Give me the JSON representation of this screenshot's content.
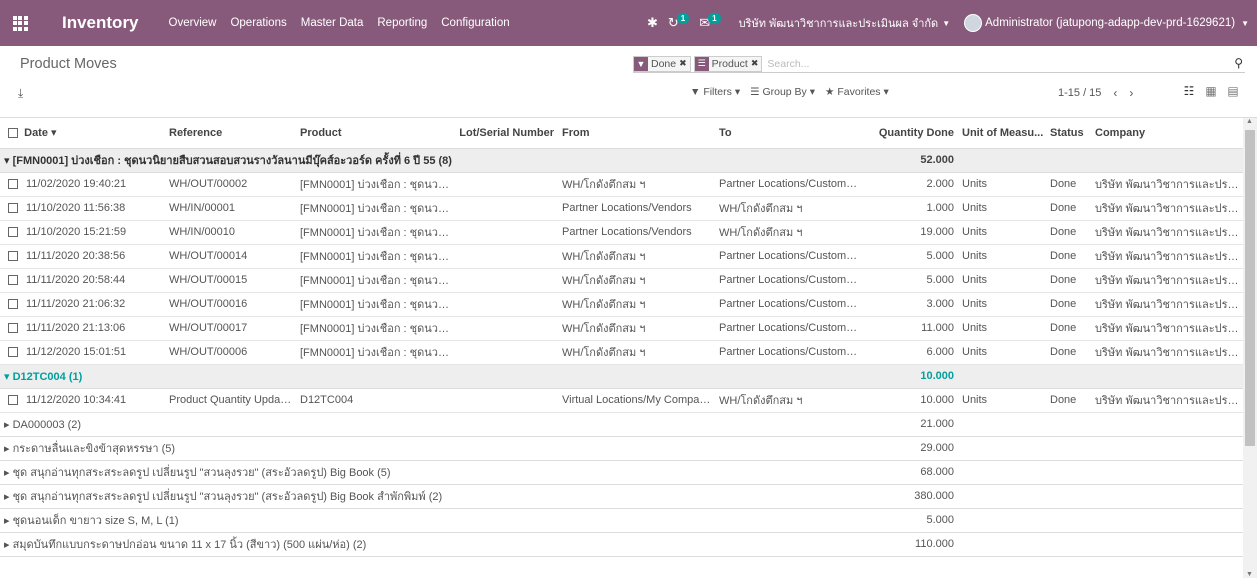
{
  "navbar": {
    "app_title": "Inventory",
    "menu": [
      "Overview",
      "Operations",
      "Master Data",
      "Reporting",
      "Configuration"
    ],
    "activity_badge": "1",
    "messages_badge": "1",
    "company": "บริษัท พัฒนาวิชาการและประเมินผล จำกัด",
    "user": "Administrator (jatupong-adapp-dev-prd-1629621)"
  },
  "control_panel": {
    "breadcrumb": "Product Moves",
    "facets": [
      "Done",
      "Product"
    ],
    "search_placeholder": "Search...",
    "filters_label": "Filters",
    "groupby_label": "Group By",
    "favorites_label": "Favorites",
    "pager": "1-15 / 15"
  },
  "columns": [
    "Date",
    "Reference",
    "Product",
    "Lot/Serial Number",
    "From",
    "To",
    "Quantity Done",
    "Unit of Measu...",
    "Status",
    "Company"
  ],
  "groups": [
    {
      "label": "▾ [FMN0001] บ่วงเชือก : ชุดนวนิยายสืบสวนสอบสวนรางวัลนานมีบุ๊คส์อะวอร์ด ครั้งที่ 6 ปี 55 (8)",
      "total": "52.000",
      "state": "open",
      "rows": [
        {
          "date": "11/02/2020 19:40:21",
          "ref": "WH/OUT/00002",
          "product": "[FMN0001] บ่วงเชือก : ชุดนวนิย...",
          "lot": "",
          "from": "WH/โกดังตึกสม ฯ",
          "to": "Partner Locations/Custome...",
          "qty": "2.000",
          "uom": "Units",
          "status": "Done",
          "company": "บริษัท พัฒนาวิชาการและประเมิ..."
        },
        {
          "date": "11/10/2020 11:56:38",
          "ref": "WH/IN/00001",
          "product": "[FMN0001] บ่วงเชือก : ชุดนวนิย...",
          "lot": "",
          "from": "Partner Locations/Vendors",
          "to": "WH/โกดังตึกสม ฯ",
          "qty": "1.000",
          "uom": "Units",
          "status": "Done",
          "company": "บริษัท พัฒนาวิชาการและประเมิ..."
        },
        {
          "date": "11/10/2020 15:21:59",
          "ref": "WH/IN/00010",
          "product": "[FMN0001] บ่วงเชือก : ชุดนวนิย...",
          "lot": "",
          "from": "Partner Locations/Vendors",
          "to": "WH/โกดังตึกสม ฯ",
          "qty": "19.000",
          "uom": "Units",
          "status": "Done",
          "company": "บริษัท พัฒนาวิชาการและประเมิ..."
        },
        {
          "date": "11/11/2020 20:38:56",
          "ref": "WH/OUT/00014",
          "product": "[FMN0001] บ่วงเชือก : ชุดนวนิย...",
          "lot": "",
          "from": "WH/โกดังตึกสม ฯ",
          "to": "Partner Locations/Custome...",
          "qty": "5.000",
          "uom": "Units",
          "status": "Done",
          "company": "บริษัท พัฒนาวิชาการและประเมิ..."
        },
        {
          "date": "11/11/2020 20:58:44",
          "ref": "WH/OUT/00015",
          "product": "[FMN0001] บ่วงเชือก : ชุดนวนิย...",
          "lot": "",
          "from": "WH/โกดังตึกสม ฯ",
          "to": "Partner Locations/Custome...",
          "qty": "5.000",
          "uom": "Units",
          "status": "Done",
          "company": "บริษัท พัฒนาวิชาการและประเมิ..."
        },
        {
          "date": "11/11/2020 21:06:32",
          "ref": "WH/OUT/00016",
          "product": "[FMN0001] บ่วงเชือก : ชุดนวนิย...",
          "lot": "",
          "from": "WH/โกดังตึกสม ฯ",
          "to": "Partner Locations/Custome...",
          "qty": "3.000",
          "uom": "Units",
          "status": "Done",
          "company": "บริษัท พัฒนาวิชาการและประเมิ..."
        },
        {
          "date": "11/11/2020 21:13:06",
          "ref": "WH/OUT/00017",
          "product": "[FMN0001] บ่วงเชือก : ชุดนวนิย...",
          "lot": "",
          "from": "WH/โกดังตึกสม ฯ",
          "to": "Partner Locations/Custome...",
          "qty": "11.000",
          "uom": "Units",
          "status": "Done",
          "company": "บริษัท พัฒนาวิชาการและประเมิ..."
        },
        {
          "date": "11/12/2020 15:01:51",
          "ref": "WH/OUT/00006",
          "product": "[FMN0001] บ่วงเชือก : ชุดนวนิย...",
          "lot": "",
          "from": "WH/โกดังตึกสม ฯ",
          "to": "Partner Locations/Custome...",
          "qty": "6.000",
          "uom": "Units",
          "status": "Done",
          "company": "บริษัท พัฒนาวิชาการและประเมิ..."
        }
      ]
    },
    {
      "label": "▾ D12TC004 (1)",
      "total": "10.000",
      "state": "teal",
      "rows": [
        {
          "date": "11/12/2020 10:34:41",
          "ref": "Product Quantity Updated",
          "product": "D12TC004",
          "lot": "",
          "from": "Virtual Locations/My Compan...",
          "to": "WH/โกดังตึกสม ฯ",
          "qty": "10.000",
          "uom": "Units",
          "status": "Done",
          "company": "บริษัท พัฒนาวิชาการและประเมิ..."
        }
      ]
    },
    {
      "label": "▸ DA000003 (2)",
      "total": "21.000",
      "state": "collapsed",
      "rows": []
    },
    {
      "label": "▸ กระดาษลื่นและขิงข้าสุดหรรษา (5)",
      "total": "29.000",
      "state": "collapsed",
      "rows": []
    },
    {
      "label": "▸ ชุด สนุกอ่านทุกสระสระลดรูป เปลี่ยนรูป \"สวนลุงรวย\" (สระอัวลดรูป) Big Book (5)",
      "total": "68.000",
      "state": "collapsed",
      "rows": []
    },
    {
      "label": "▸ ชุด สนุกอ่านทุกสระสระลดรูป เปลี่ยนรูป \"สวนลุงรวย\" (สระอัวลดรูป) Big Book สำพักพิมพ์ (2)",
      "total": "380.000",
      "state": "collapsed",
      "rows": []
    },
    {
      "label": "▸ ชุดนอนเด็ก ขายาว size S, M, L (1)",
      "total": "5.000",
      "state": "collapsed",
      "rows": []
    },
    {
      "label": "▸ สมุดบันทึกแบบกระดาษปกอ่อน ขนาด 11 x 17 นิ้ว (สีขาว) (500 แผ่น/ห่อ) (2)",
      "total": "110.000",
      "state": "collapsed",
      "rows": []
    }
  ]
}
